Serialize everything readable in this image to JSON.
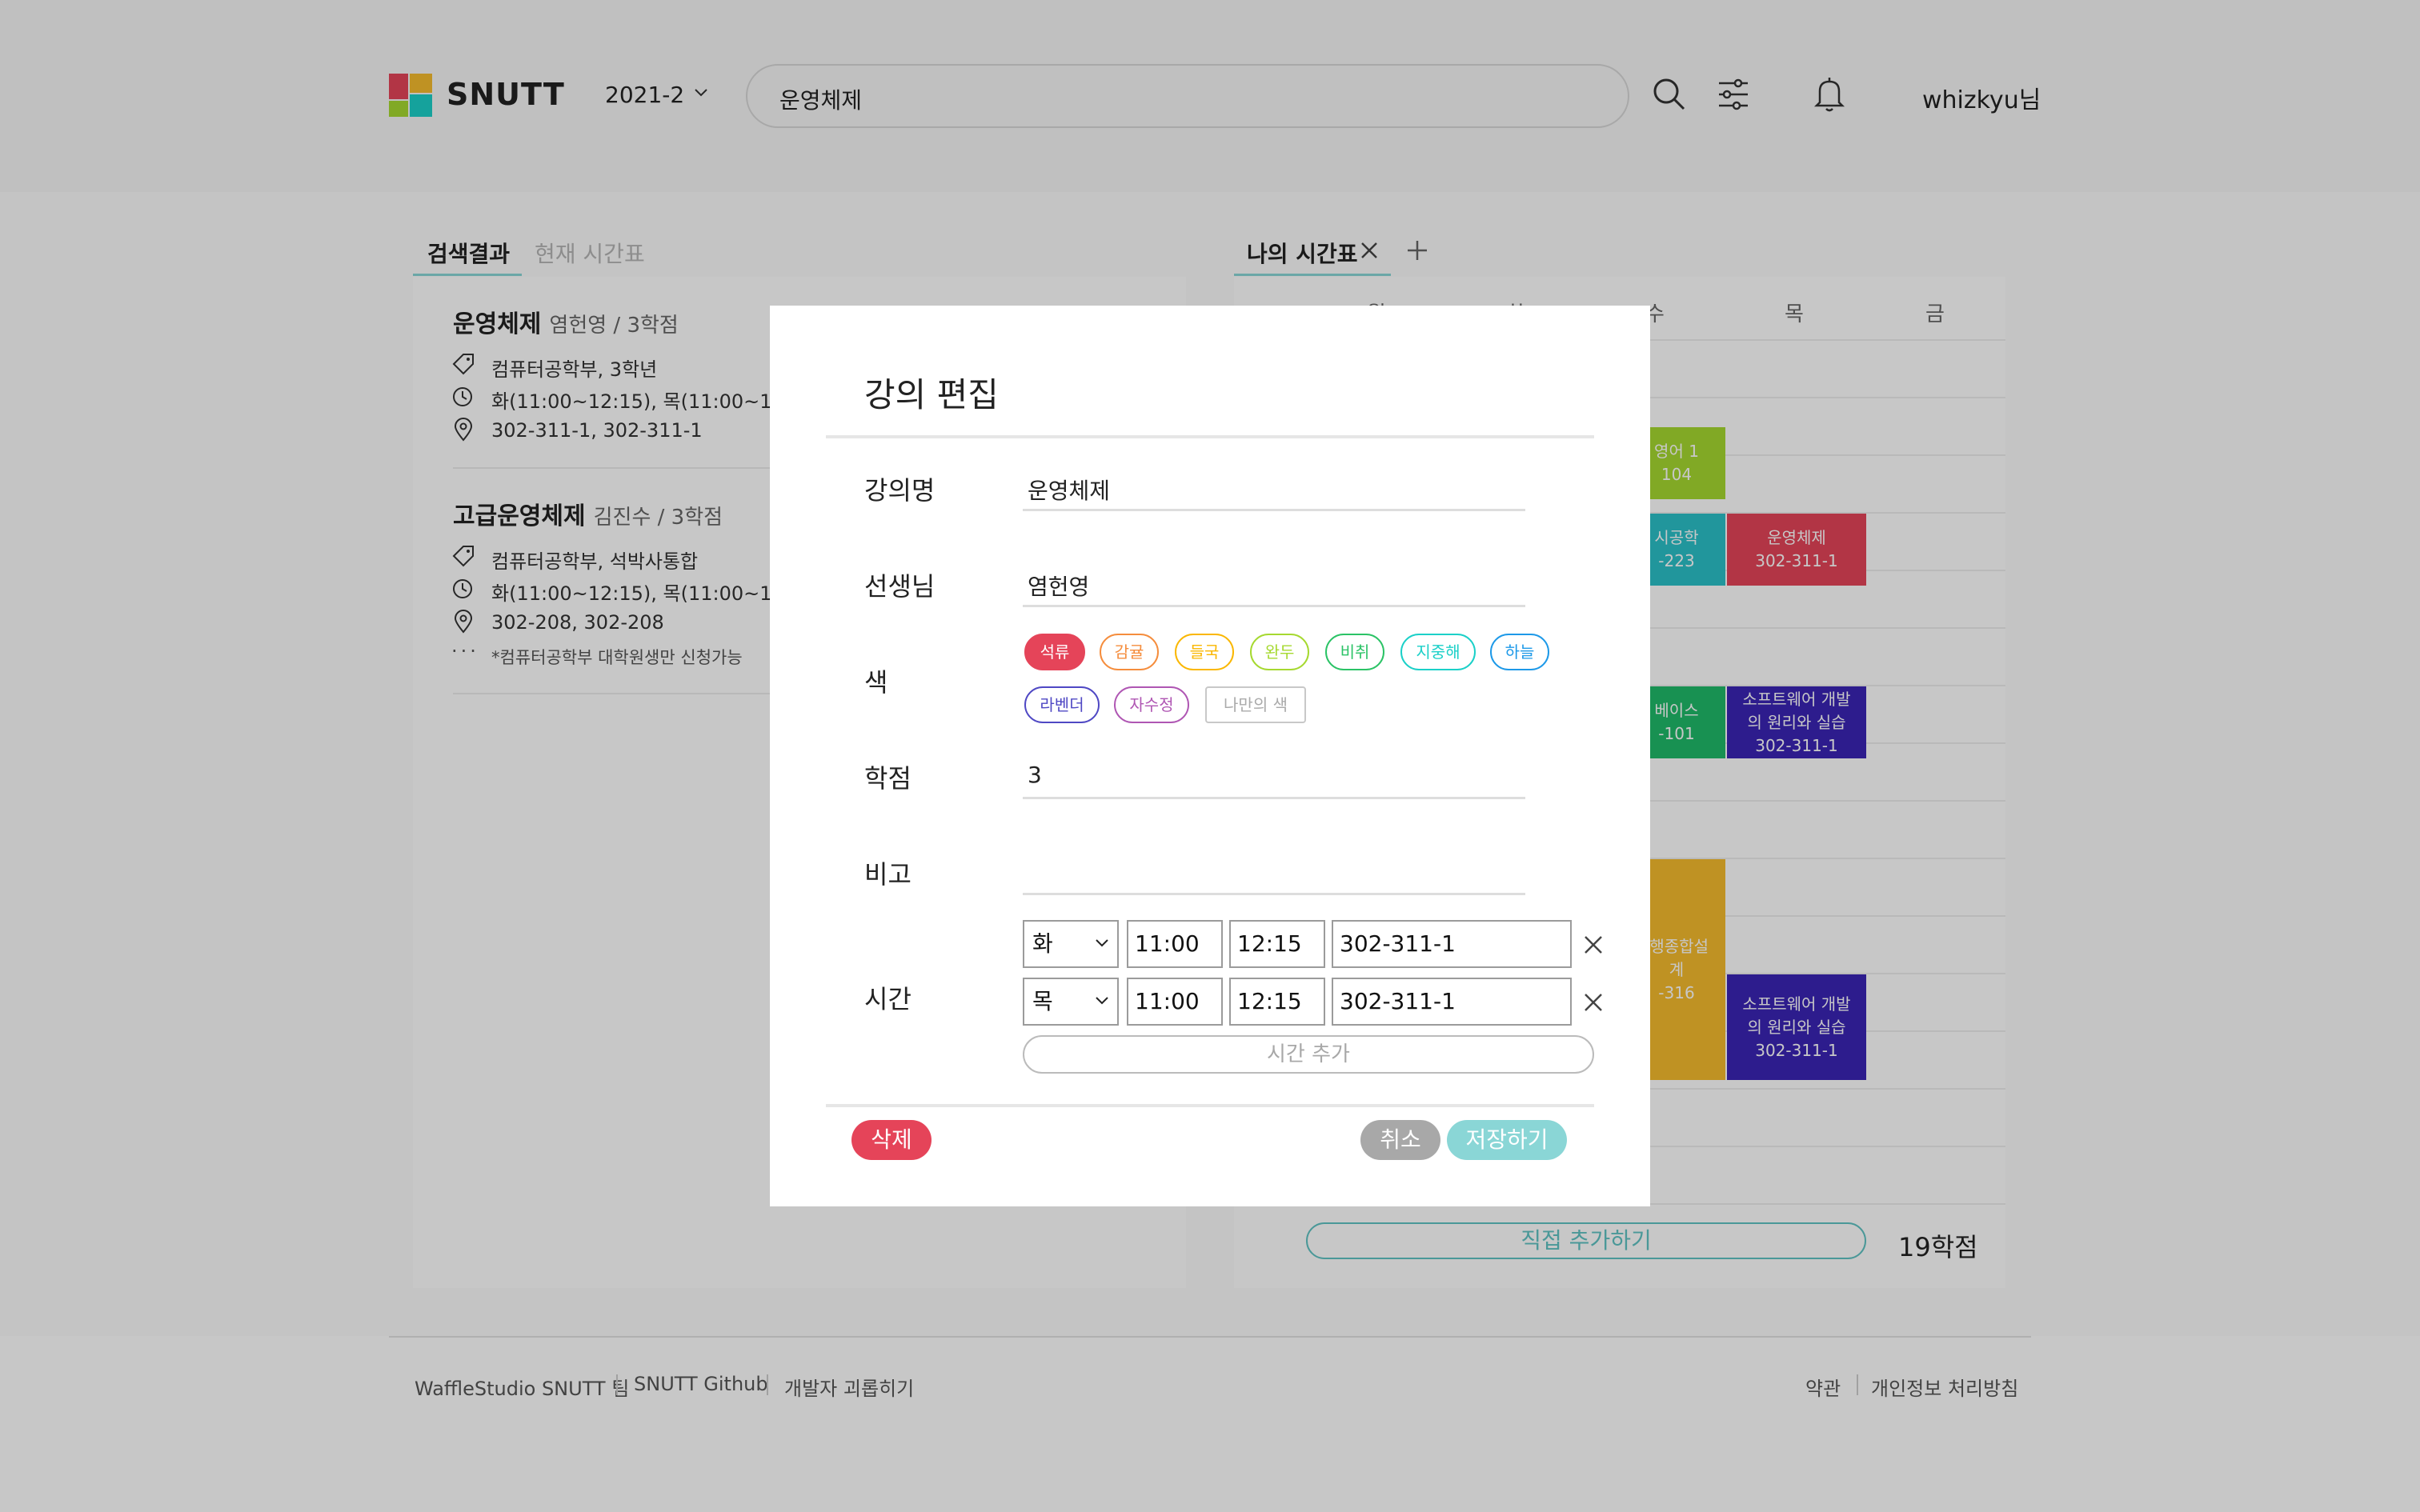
{
  "header": {
    "logo_text": "SNUTT",
    "semester": "2021-2",
    "search_value": "운영체제",
    "username": "whizkyu님"
  },
  "left_tabs": [
    "검색결과",
    "현재 시간표"
  ],
  "search_results": [
    {
      "title": "운영체제",
      "sub": "염헌영 / 3학점",
      "dept": "컴퓨터공학부, 3학년",
      "time": "화(11:00~12:15), 목(11:00~12:15)",
      "place": "302-311-1, 302-311-1",
      "note": ""
    },
    {
      "title": "고급운영체제",
      "sub": "김진수 / 3학점",
      "dept": "컴퓨터공학부, 석박사통합",
      "time": "화(11:00~12:15), 목(11:00~12:15)",
      "place": "302-208, 302-208",
      "note": "*컴퓨터공학부 대학원생만 신청가능"
    }
  ],
  "timetable": {
    "tab_label": "나의 시간표",
    "days": [
      "월",
      "화",
      "수",
      "목",
      "금"
    ],
    "blocks": [
      {
        "line1": "영어 1",
        "line2": "104",
        "color": "#a6d930"
      },
      {
        "line1": "시공학",
        "line2": "-223",
        "color": "#2bc0c8"
      },
      {
        "line1": "운영체제",
        "line2": "302-311-1",
        "color": "#e54459"
      },
      {
        "line1": "베이스",
        "line2": "-101",
        "color": "#1fba6a"
      },
      {
        "line1": "소프트웨어 개발",
        "line2": "의 원리와 실습",
        "line3": "302-311-1",
        "color": "#3a25b5"
      },
      {
        "line1": "·행종합설",
        "line2": "계",
        "line3": "-316",
        "color": "#f5bb2d"
      },
      {
        "line1": "소프트웨어 개발",
        "line2": "의 원리와 실습",
        "line3": "302-311-1",
        "color": "#3a25b5"
      }
    ],
    "add_direct_label": "직접 추가하기",
    "total_credits": "19학점"
  },
  "footer": {
    "left_links": [
      "WaffleStudio SNUTT 팀",
      "SNUTT Github",
      "개발자 괴롭히기"
    ],
    "right_links": [
      "약관",
      "개인정보 처리방침"
    ]
  },
  "modal": {
    "title": "강의 편집",
    "labels": {
      "name": "강의명",
      "instructor": "선생님",
      "color": "색",
      "credit": "학점",
      "remark": "비고",
      "time": "시간"
    },
    "values": {
      "name": "운영체제",
      "instructor": "염헌영",
      "credit": "3",
      "remark": ""
    },
    "colors": [
      {
        "name": "석류",
        "hex": "#e54459",
        "selected": true
      },
      {
        "name": "감귤",
        "hex": "#f58d3d",
        "selected": false
      },
      {
        "name": "들국",
        "hex": "#fab701",
        "selected": false
      },
      {
        "name": "완두",
        "hex": "#a6d930",
        "selected": false
      },
      {
        "name": "비취",
        "hex": "#2bc366",
        "selected": false
      },
      {
        "name": "지중해",
        "hex": "#1bd0c8",
        "selected": false
      },
      {
        "name": "하늘",
        "hex": "#1d99e8",
        "selected": false
      },
      {
        "name": "라벤더",
        "hex": "#4f48c4",
        "selected": false
      },
      {
        "name": "자수정",
        "hex": "#af56b3",
        "selected": false
      }
    ],
    "custom_color_label": "나만의  색",
    "times": [
      {
        "day": "화",
        "start": "11:00",
        "end": "12:15",
        "place": "302-311-1"
      },
      {
        "day": "목",
        "start": "11:00",
        "end": "12:15",
        "place": "302-311-1"
      }
    ],
    "add_time_label": "시간 추가",
    "delete_label": "삭제",
    "cancel_label": "취소",
    "save_label": "저장하기",
    "accent": "#8ad6d6",
    "delete_color": "#e54459"
  }
}
